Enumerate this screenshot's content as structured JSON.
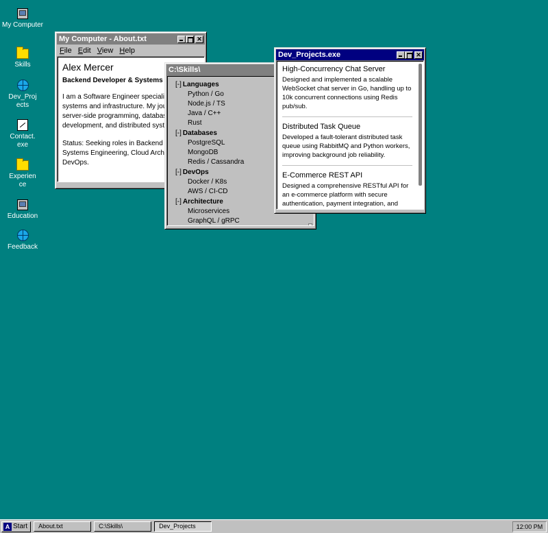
{
  "desktop": {
    "icons": [
      {
        "label": "My Computer",
        "icon": "computer-icon"
      },
      {
        "label": "Skills",
        "icon": "folder-icon"
      },
      {
        "label": "Dev_Projects",
        "icon": "globe-icon"
      },
      {
        "label": "Contact.exe",
        "icon": "document-icon"
      },
      {
        "label": "Experience",
        "icon": "folder-icon"
      },
      {
        "label": "Education",
        "icon": "computer-icon"
      },
      {
        "label": "Feedback",
        "icon": "globe-icon"
      }
    ]
  },
  "about_window": {
    "title": "My Computer - About.txt",
    "menu": [
      "File",
      "Edit",
      "View",
      "Help"
    ],
    "name": "Alex Mercer",
    "role": "Backend Developer & Systems Engineer",
    "bio": "I am a Software Engineer specializing in backend systems and infrastructure. My journey merges server-side programming, database architecture, API development, and distributed systems.",
    "status": "Status: Seeking roles in Backend Development, Systems Engineering, Cloud Architecture, and DevOps."
  },
  "skills_window": {
    "title": "C:\\Skills\\",
    "groups": [
      {
        "toggle": "[-]",
        "name": "Languages",
        "items": [
          "Python / Go",
          "Node.js / TS",
          "Java / C++",
          "Rust"
        ]
      },
      {
        "toggle": "[-]",
        "name": "Databases",
        "items": [
          "PostgreSQL",
          "MongoDB",
          "Redis / Cassandra"
        ]
      },
      {
        "toggle": "[-]",
        "name": "DevOps",
        "items": [
          "Docker / K8s",
          "AWS / CI-CD"
        ]
      },
      {
        "toggle": "[-]",
        "name": "Architecture",
        "items": [
          "Microservices",
          "GraphQL / gRPC"
        ]
      }
    ]
  },
  "projects_window": {
    "title": "Dev_Projects.exe",
    "projects": [
      {
        "title": "High-Concurrency Chat Server",
        "description": "Designed and implemented a scalable WebSocket chat server in Go, handling up to 10k concurrent connections using Redis pub/sub."
      },
      {
        "title": "Distributed Task Queue",
        "description": "Developed a fault-tolerant distributed task queue using RabbitMQ and Python workers, improving background job reliability."
      },
      {
        "title": "E-Commerce REST API",
        "description": "Designed a comprehensive RESTful API for an e-commerce platform with secure authentication, payment integration, and"
      }
    ]
  },
  "taskbar": {
    "start_label": "Start",
    "start_logo": "A",
    "tasks": [
      "About.txt",
      "C:\\Skills\\",
      "Dev_Projects"
    ],
    "clock": "12:00 PM"
  },
  "colors": {
    "desktop": "#008080",
    "active_title": "#000080",
    "inactive_title": "#808080",
    "chrome": "#c0c0c0"
  }
}
